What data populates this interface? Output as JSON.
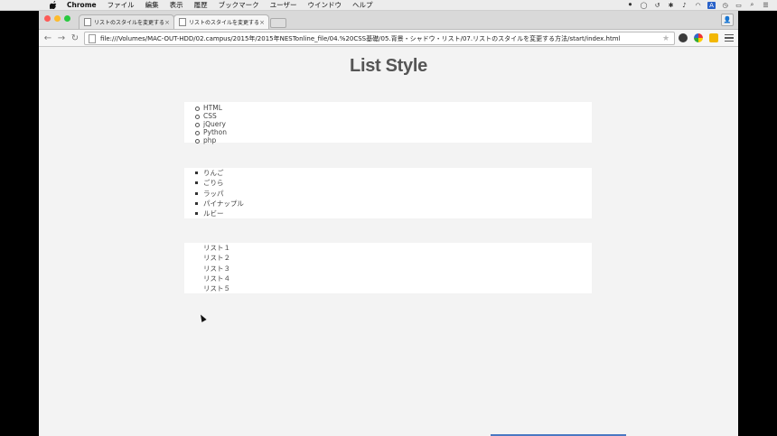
{
  "menubar": {
    "app": "Chrome",
    "items": [
      "ファイル",
      "編集",
      "表示",
      "履歴",
      "ブックマーク",
      "ユーザー",
      "ウインドウ",
      "ヘルプ"
    ]
  },
  "browser": {
    "tabs": [
      {
        "title": "リストのスタイルを変更する",
        "active": false
      },
      {
        "title": "リストのスタイルを変更する",
        "active": true
      }
    ],
    "url": "file:///Volumes/MAC-OUT-HDD/02.campus/2015年/2015年NESTonline_file/04.%20CSS基礎/05.背景・シャドウ・リスト/07.リストのスタイルを変更する方法/start/index.html"
  },
  "page": {
    "title": "List Style",
    "list1": {
      "marker": "circle",
      "items": [
        "HTML",
        "CSS",
        "jQuery",
        "Python",
        "php"
      ]
    },
    "list2": {
      "marker": "square",
      "items": [
        "りんご",
        "ごりら",
        "ラッパ",
        "パイナップル",
        "ルビー"
      ]
    },
    "list3": {
      "marker": "none",
      "items": [
        "リスト１",
        "リスト２",
        "リスト３",
        "リスト４",
        "リスト５"
      ]
    }
  }
}
